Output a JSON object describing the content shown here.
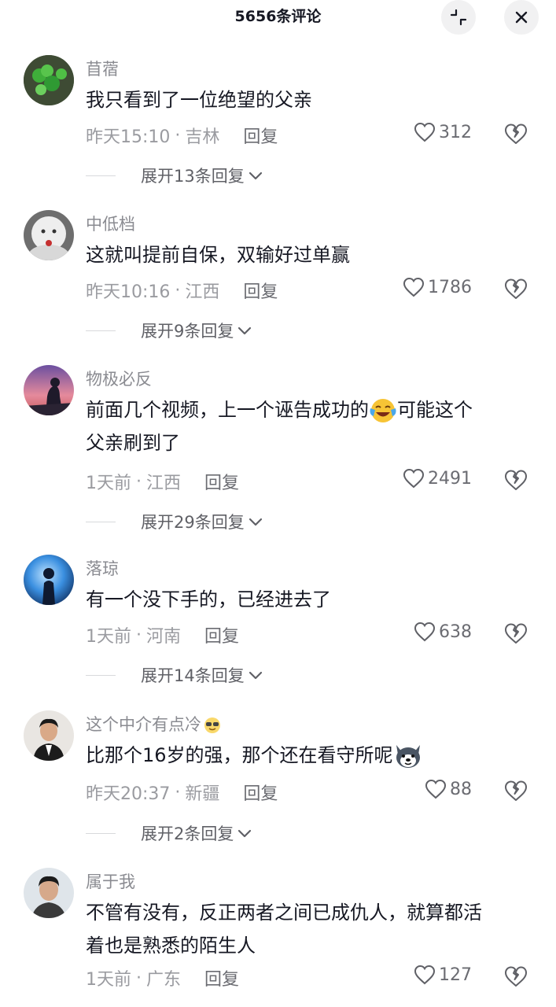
{
  "header": {
    "title": "5656条评论"
  },
  "comments": [
    {
      "username": "苜蓿",
      "lines": [
        "我只看到了一位绝望的父亲"
      ],
      "time": "昨天15:10",
      "location": "吉林",
      "reply_label": "回复",
      "likes": "312",
      "expand_label": "展开13条回复"
    },
    {
      "username": "中低档",
      "lines": [
        "这就叫提前自保，双输好过单赢"
      ],
      "time": "昨天10:16",
      "location": "江西",
      "reply_label": "回复",
      "likes": "1786",
      "expand_label": "展开9条回复"
    },
    {
      "username": "物极必反",
      "line1_before": "前面几个视频，上一个诬告成功的",
      "line1_after": "可能这个",
      "line2": "父亲刷到了",
      "time": "1天前",
      "location": "江西",
      "reply_label": "回复",
      "likes": "2491",
      "expand_label": "展开29条回复"
    },
    {
      "username": "落琼",
      "lines": [
        "有一个没下手的，已经进去了"
      ],
      "time": "1天前",
      "location": "河南",
      "reply_label": "回复",
      "likes": "638",
      "expand_label": "展开14条回复"
    },
    {
      "username": "这个中介有点冷",
      "line1": "比那个16岁的强，那个还在看守所呢",
      "time": "昨天20:37",
      "location": "新疆",
      "reply_label": "回复",
      "likes": "88",
      "expand_label": "展开2条回复"
    },
    {
      "username": "属于我",
      "lines": [
        "不管有没有，反正两者之间已成仇人，就算都活",
        "着也是熟悉的陌生人"
      ],
      "time": "1天前",
      "location": "广东",
      "reply_label": "回复",
      "likes": "127"
    }
  ],
  "icons": {
    "collapse": "collapse-icon",
    "close": "close-icon",
    "like": "heart-icon",
    "dislike": "broken-heart-icon",
    "expand": "chevron-down-icon"
  },
  "colors": {
    "text": "#161823",
    "secondary": "#8a8b91"
  }
}
